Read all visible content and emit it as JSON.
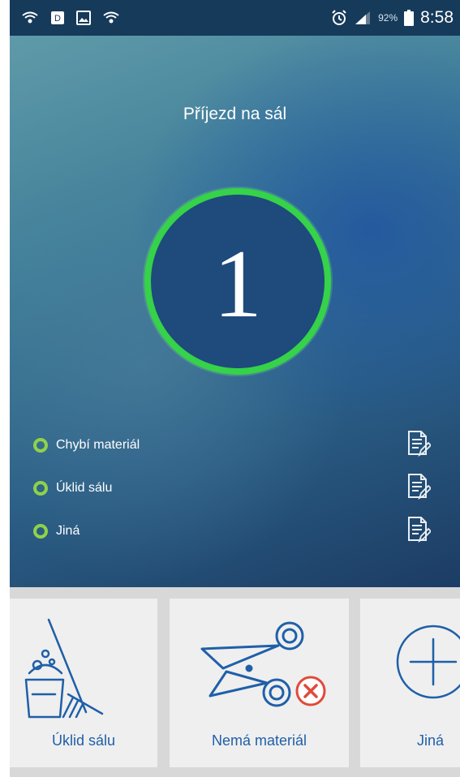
{
  "status_bar": {
    "left_icons": [
      "wifi-call-icon",
      "sim-icon",
      "gallery-icon",
      "wifi-call-icon"
    ],
    "alarm_icon": "alarm-icon",
    "signal_icon": "signal-icon",
    "battery_percent": "92%",
    "time": "8:58"
  },
  "hero": {
    "title": "Příjezd na sál",
    "count": "1",
    "colors": {
      "ring": "#35d24a",
      "circle": "#1e4a7c",
      "dot": "#8fd24a"
    }
  },
  "issues": [
    {
      "label": "Chybí materiál",
      "icon": "document-edit-icon"
    },
    {
      "label": "Úklid sálu",
      "icon": "document-edit-icon"
    },
    {
      "label": "Jiná",
      "icon": "document-edit-icon"
    }
  ],
  "actions": [
    {
      "label": "Úklid sálu",
      "icon": "cleaning-bucket-icon"
    },
    {
      "label": "Nemá materiál",
      "icon": "scissors-cancel-icon"
    },
    {
      "label": "Jiná",
      "icon": "plus-circle-icon"
    }
  ],
  "accent_color": "#1f5fa8"
}
